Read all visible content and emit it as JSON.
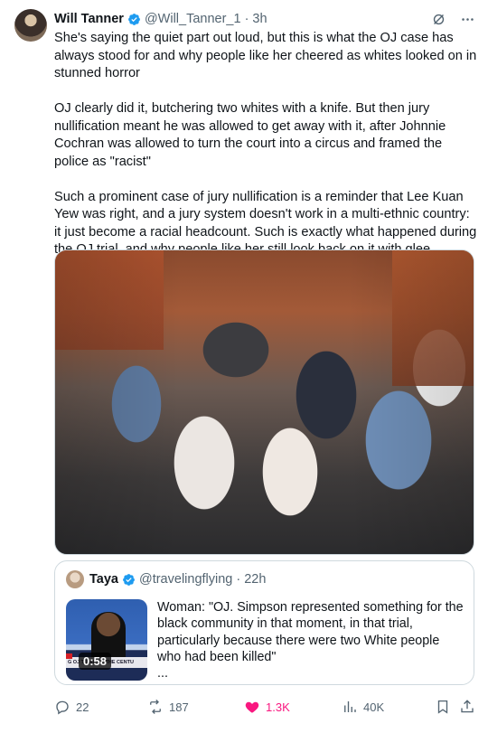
{
  "author": {
    "name": "Will Tanner",
    "handle": "@Will_Tanner_1",
    "separator": "·",
    "time": "3h"
  },
  "tweet": {
    "paragraphs": [
      "She's saying the quiet part out loud, but this is what the OJ case has always stood for and why people like her cheered as whites looked on in stunned horror",
      "OJ clearly did it, butchering two whites with a knife. But then jury nullification meant he was allowed to get away with it, after Johnnie Cochran was allowed to turn the court into a circus and framed the police as \"racist\"",
      "Such a prominent case of jury nullification is a reminder that Lee Kuan Yew was right, and a jury system doesn't work in a multi-ethnic country: it just become a racial headcount. Such is exactly what happened during the OJ trial, and why people like her still look back on it with glee"
    ]
  },
  "quote": {
    "name": "Taya",
    "handle": "@travelingflying",
    "separator": "·",
    "time": "22h",
    "video_duration": "0:58",
    "video_banner": "G OJ  TRIAL OF THE CENTU",
    "text": "Woman: \"OJ. Simpson represented something for the black community in that moment, in that trial, particularly because there were two White people who had been killed\"",
    "ellipsis": "..."
  },
  "stats": {
    "replies": "22",
    "reposts": "187",
    "likes": "1.3K",
    "views": "40K"
  },
  "colors": {
    "verified": "#1d9bf0",
    "like": "#f91880",
    "secondary_text": "#536471",
    "border": "#cfd9de"
  },
  "icons": [
    "verified-badge-icon",
    "grok-icon",
    "more-icon",
    "reply-icon",
    "repost-icon",
    "like-icon",
    "views-icon",
    "bookmark-icon",
    "share-icon"
  ]
}
